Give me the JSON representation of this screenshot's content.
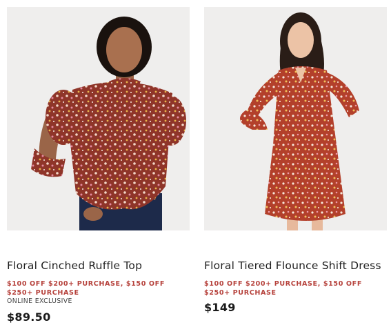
{
  "products": [
    {
      "name": "Floral Cinched Ruffle Top",
      "promo": "$100 OFF $200+ PURCHASE, $150 OFF $250+ PURCHASE",
      "badge": "ONLINE EXCLUSIVE",
      "price": "$89.50"
    },
    {
      "name": "Floral Tiered Flounce Shift Dress",
      "promo": "$100 OFF $200+ PURCHASE, $150 OFF $250+ PURCHASE",
      "price": "$149"
    }
  ],
  "colors": {
    "promo": "#b6423c",
    "photo_background": "#efeeed",
    "fabric": "#8f3529"
  }
}
